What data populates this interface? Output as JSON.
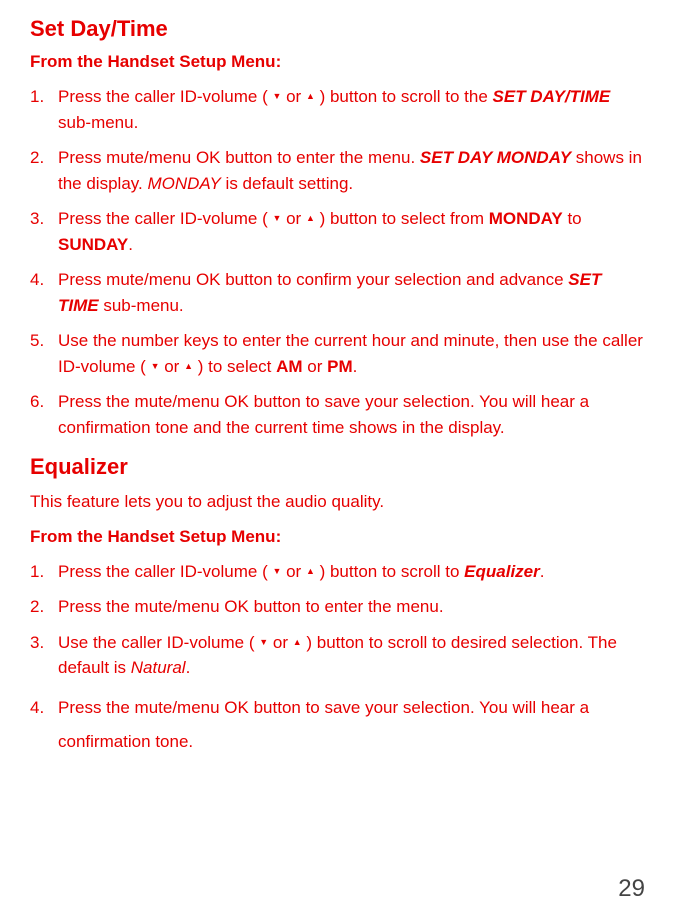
{
  "section1": {
    "heading": "Set Day/Time",
    "subheading": "From the Handset Setup Menu:",
    "items": [
      {
        "num": "1.",
        "t1": "Press the caller ID-volume ( ",
        "down": "▼",
        "or": " or ",
        "up": "▲",
        "t2": " ) button to scroll to the ",
        "bi1": "SET DAY/TIME",
        "t3": " sub-menu."
      },
      {
        "num": "2.",
        "t1": "Press mute/menu OK button to enter the menu. ",
        "bi1": "SET DAY MONDAY",
        "t2": " shows in the display. ",
        "i1": "MONDAY",
        "t3": " is default setting."
      },
      {
        "num": "3.",
        "t1": "Press the caller ID-volume ( ",
        "down": "▼",
        "or": " or ",
        "up": "▲",
        "t2": " ) button to select from ",
        "b1": "MONDAY",
        "t3": " to ",
        "b2": "SUNDAY",
        "t4": "."
      },
      {
        "num": "4.",
        "t1": "Press mute/menu OK button to confirm your selection and advance ",
        "bi1": "SET TIME",
        "t2": " sub-menu."
      },
      {
        "num": "5.",
        "t1": "Use the number keys to enter the current hour and minute, then use the caller ID-volume ( ",
        "down": "▼",
        "or": "  or ",
        "up": "▲",
        "t2": " ) to select ",
        "b1": "AM",
        "t3": " or ",
        "b2": "PM",
        "t4": "."
      },
      {
        "num": "6.",
        "t1": "Press the mute/menu OK button to save your selection. You will hear a confirmation tone and the current time shows in the display."
      }
    ]
  },
  "section2": {
    "heading": "Equalizer",
    "intro": "This feature lets you to adjust the audio quality.",
    "subheading": "From the Handset Setup Menu:",
    "items": [
      {
        "num": "1.",
        "t1": "Press the caller ID-volume ( ",
        "down": "▼",
        "or": " or ",
        "up": "▲",
        "t2": " ) button to scroll to ",
        "bi1": "Equalizer",
        "t3": "."
      },
      {
        "num": "2.",
        "t1": "Press the mute/menu OK button to enter the menu."
      },
      {
        "num": "3.",
        "t1": "Use the caller ID-volume ( ",
        "down": "▼",
        "or": "  or  ",
        "up": "▲",
        "t2": " ) button to scroll to desired selection. The default is ",
        "i1": "Natural",
        "t3": "."
      },
      {
        "num": "4.",
        "t1": "Press the mute/menu OK button to save your selection. You will hear a confirmation tone."
      }
    ]
  },
  "page_number": "29"
}
